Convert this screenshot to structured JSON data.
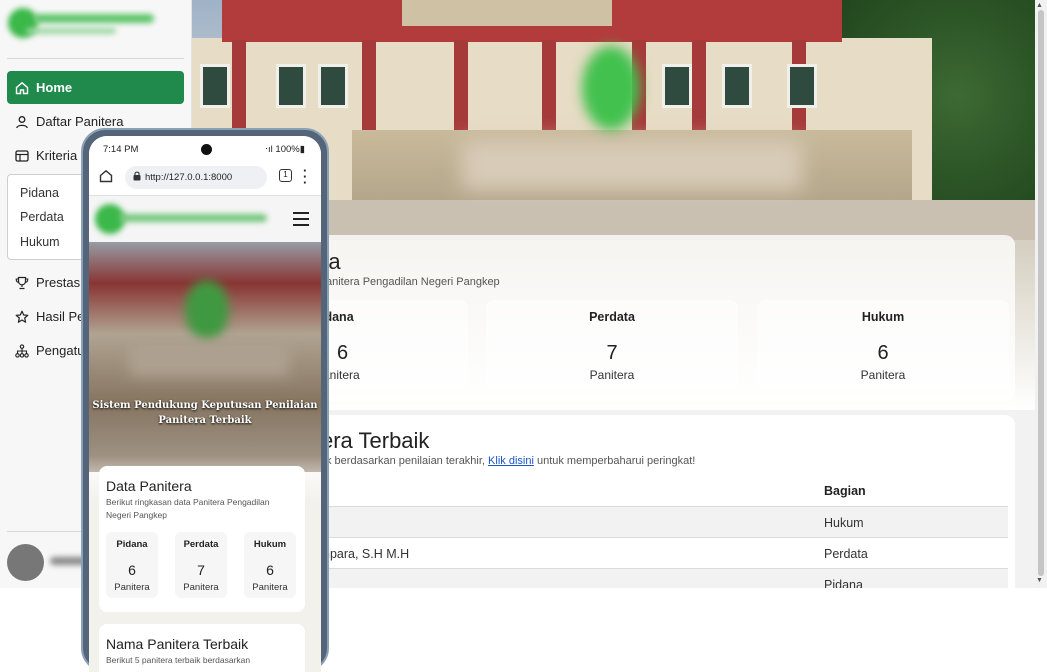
{
  "sidebar": {
    "items": [
      {
        "label": "Home"
      },
      {
        "label": "Daftar Panitera"
      },
      {
        "label": "Kriteria P"
      },
      {
        "label": "Prestasi"
      },
      {
        "label": "Hasil Pen"
      },
      {
        "label": "Pengatu"
      }
    ],
    "submenu": [
      "Pidana",
      "Perdata",
      "Hukum"
    ]
  },
  "main": {
    "data_card": {
      "title": "ra",
      "subtitle": "anitera Pengadilan Negeri Pangkep",
      "stats": [
        {
          "label": "idana",
          "value": "6",
          "unit": "anitera"
        },
        {
          "label": "Perdata",
          "value": "7",
          "unit": "Panitera"
        },
        {
          "label": "Hukum",
          "value": "6",
          "unit": "Panitera"
        }
      ]
    },
    "top_card": {
      "title": "era Terbaik",
      "subtitle_pre": "k berdasarkan penilaian terakhir,",
      "link": "Klik disini",
      "subtitle_post": "untuk memperbaharui peringkat!",
      "col_header": "Bagian",
      "rows": [
        {
          "name": "",
          "bagian": "Hukum"
        },
        {
          "name": "npara, S.H M.H",
          "bagian": "Perdata"
        },
        {
          "name": "",
          "bagian": "Pidana"
        }
      ]
    }
  },
  "phone": {
    "status_time": "7:14 PM",
    "status_battery": "100%",
    "url": "http://127.0.0.1:8000",
    "tab_count": "1",
    "hero_caption_line1": "Sistem Pendukung Keputusan Penilaian",
    "hero_caption_line2": "Panitera Terbaik",
    "data_card": {
      "title": "Data Panitera",
      "subtitle": "Berikut ringkasan data Panitera Pengadilan Negeri Pangkep",
      "stats": [
        {
          "label": "Pidana",
          "value": "6",
          "unit": "Panitera"
        },
        {
          "label": "Perdata",
          "value": "7",
          "unit": "Panitera"
        },
        {
          "label": "Hukum",
          "value": "6",
          "unit": "Panitera"
        }
      ]
    },
    "top_card": {
      "title": "Nama Panitera Terbaik",
      "subtitle": "Berikut 5 panitera terbaik berdasarkan"
    }
  },
  "colors": {
    "accent": "#1f8a4b",
    "link": "#1a55c9"
  },
  "icons": [
    "home-icon",
    "user-icon",
    "table-icon",
    "trophy-icon",
    "star-icon",
    "sitemap-icon"
  ]
}
